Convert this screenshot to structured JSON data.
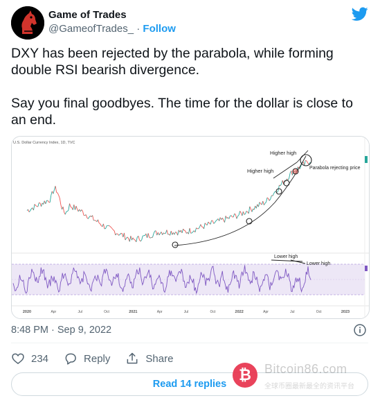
{
  "author": {
    "name": "Game of Trades",
    "handle": "@GameofTrades_",
    "separator": "·",
    "follow_label": "Follow"
  },
  "tweet": {
    "text": "DXY has been rejected by the parabola, while forming double RSI bearish divergence.\n\nSay you final goodbyes. The time for the dollar is close to an end.",
    "timestamp": "8:48 PM · Sep 9, 2022"
  },
  "chart": {
    "header": "U.S. Dollar Currency Index, 1D, TVC",
    "annotations": {
      "higher_high_1": "Higher high",
      "higher_high_2": "Higher high",
      "parabola": "Parabola rejecting price",
      "lower_high_1": "Lower high",
      "lower_high_2": "Lower high"
    },
    "x_labels": [
      "2020",
      "Apr",
      "Jul",
      "Oct",
      "2021",
      "Apr",
      "Jul",
      "Oct",
      "2022",
      "Apr",
      "Jul",
      "Oct",
      "2023"
    ]
  },
  "chart_data": {
    "type": "line",
    "title": "U.S. Dollar Currency Index, 1D, TVC",
    "categories": [
      "2020",
      "Apr",
      "Jul",
      "Oct",
      "2021",
      "Apr",
      "Jul",
      "Oct",
      "2022",
      "Apr",
      "Jul",
      "Oct",
      "2023"
    ],
    "series": [
      {
        "values": [
          97,
          100,
          97,
          93,
          90,
          92,
          92,
          94,
          96,
          99,
          106,
          110,
          null
        ]
      }
    ]
  },
  "actions": {
    "like_count": "234",
    "reply_label": "Reply",
    "share_label": "Share",
    "read_replies_label": "Read 14 replies"
  },
  "watermark": {
    "text": "Bitcoin86.com",
    "sub": "全球币圈最新最全的资讯平台"
  },
  "colors": {
    "accent": "#1d9bf0",
    "price_line_up": "#26a69a",
    "price_line_down": "#ef5350",
    "rsi_line": "#7e57c2",
    "rsi_band": "#ede7f6"
  }
}
